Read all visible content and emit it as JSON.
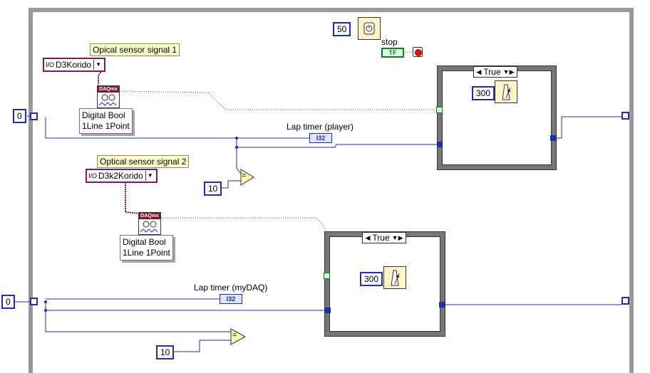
{
  "notes": {
    "sensor1": "Opical sensor signal 1",
    "sensor2": "Optical sensor signal 2"
  },
  "channels": {
    "ch1": "D3Korido",
    "ch2": "D3k2Korido"
  },
  "io_prefix": "I/O",
  "polymorphic": {
    "line1": "Digital Bool",
    "line2": "1Line 1Point"
  },
  "daq_header": "DAQmx",
  "constants": {
    "wait_ms": "50",
    "init_player": "0",
    "init_mydaq": "0",
    "compare_player": "10",
    "compare_mydaq": "10",
    "case_wait_player": "300",
    "case_wait_mydaq": "300"
  },
  "labels": {
    "stop": "stop",
    "lap_player": "Lap timer (player)",
    "lap_mydaq": "Lap timer (myDAQ)"
  },
  "indicator_type": "I32",
  "bool_tf": "TF",
  "case_selector": "True",
  "increment": "+1",
  "equal_sign": "=",
  "colors": {
    "numeric_wire": "#1e2fa8",
    "boolean_wire": "#0d7a2c",
    "daq_wire": "#7a1a6a",
    "loop_border": "#999999"
  }
}
